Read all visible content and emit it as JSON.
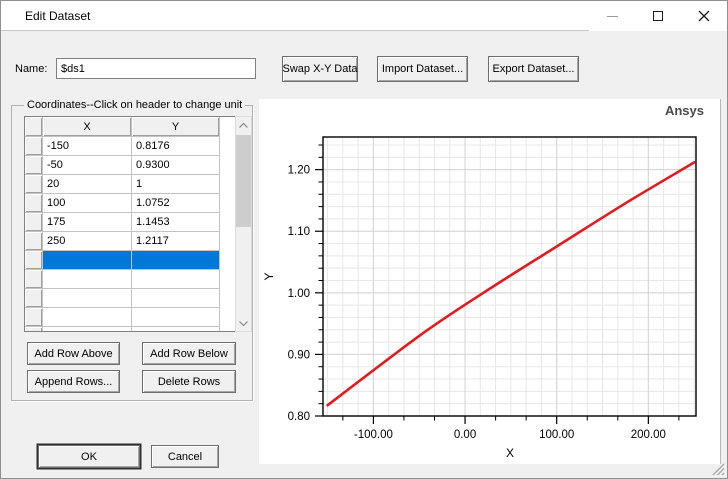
{
  "window": {
    "title": "Edit Dataset"
  },
  "form": {
    "name_label": "Name:",
    "name_value": "$ds1",
    "swap_button": "Swap X-Y Data",
    "import_button": "Import Dataset...",
    "export_button": "Export Dataset..."
  },
  "coordinates": {
    "group_label": "Coordinates--Click on header to change unit",
    "columns": [
      "X",
      "Y"
    ],
    "rows": [
      [
        "-150",
        "0.8176"
      ],
      [
        "-50",
        "0.9300"
      ],
      [
        "20",
        "1"
      ],
      [
        "100",
        "1.0752"
      ],
      [
        "175",
        "1.1453"
      ],
      [
        "250",
        "1.2117"
      ]
    ],
    "selected_row_index": 6,
    "total_visible_rows": 12,
    "buttons": {
      "add_above": "Add Row Above",
      "add_below": "Add Row Below",
      "append": "Append Rows...",
      "delete": "Delete Rows"
    }
  },
  "dialog_buttons": {
    "ok": "OK",
    "cancel": "Cancel"
  },
  "chart_data": {
    "type": "line",
    "title": "Ansys",
    "xlabel": "X",
    "ylabel": "Y",
    "x": [
      -150,
      -50,
      20,
      100,
      175,
      250
    ],
    "series": [
      {
        "name": "$ds1",
        "color": "#e31b20",
        "values": [
          0.8176,
          0.93,
          1.0,
          1.0752,
          1.1453,
          1.2117
        ]
      }
    ],
    "xlim": [
      -155,
      252
    ],
    "ylim": [
      0.8,
      1.253
    ],
    "x_major_ticks": [
      -100,
      0,
      100,
      200
    ],
    "x_tick_labels": [
      "-100.00",
      "0.00",
      "100.00",
      "200.00"
    ],
    "y_major_ticks": [
      0.8,
      0.9,
      1.0,
      1.1,
      1.2
    ],
    "y_tick_labels": [
      "0.80",
      "0.90",
      "1.00",
      "1.10",
      "1.20"
    ],
    "x_minor_tick_step": 33.333,
    "x_minor_grid_step": 16.667,
    "y_minor_step": 0.02,
    "grid": true,
    "legend": "none"
  },
  "colors": {
    "selection": "#0078d7",
    "curve": "#e31b20",
    "ansys_text": "#4a4a4a",
    "grid_minor": "#e8e8e8",
    "grid_major": "#d5d5d5"
  }
}
